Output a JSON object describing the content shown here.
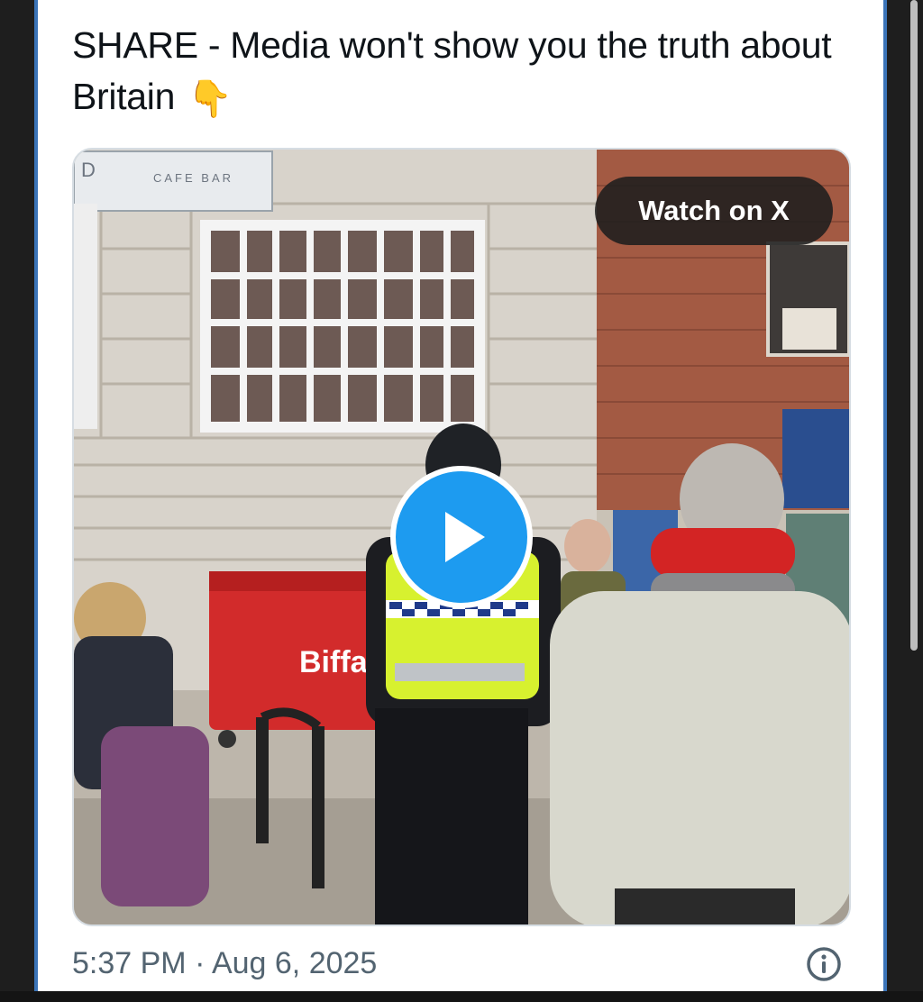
{
  "tweet": {
    "text": "SHARE - Media won't show you the truth about Britain",
    "emoji": "👇",
    "timestamp": "5:37 PM · Aug 6, 2025"
  },
  "media": {
    "watch_label": "Watch on X",
    "sign_cafe_bar": "CAFE  BAR",
    "sign_letter": "D",
    "bin_brand": "Biffa",
    "play_icon": "play-icon",
    "info_icon": "info-icon"
  },
  "colors": {
    "accent": "#1d9bf0",
    "text_primary": "#0f1419",
    "text_secondary": "#536471",
    "card_border": "#3b74b8"
  }
}
